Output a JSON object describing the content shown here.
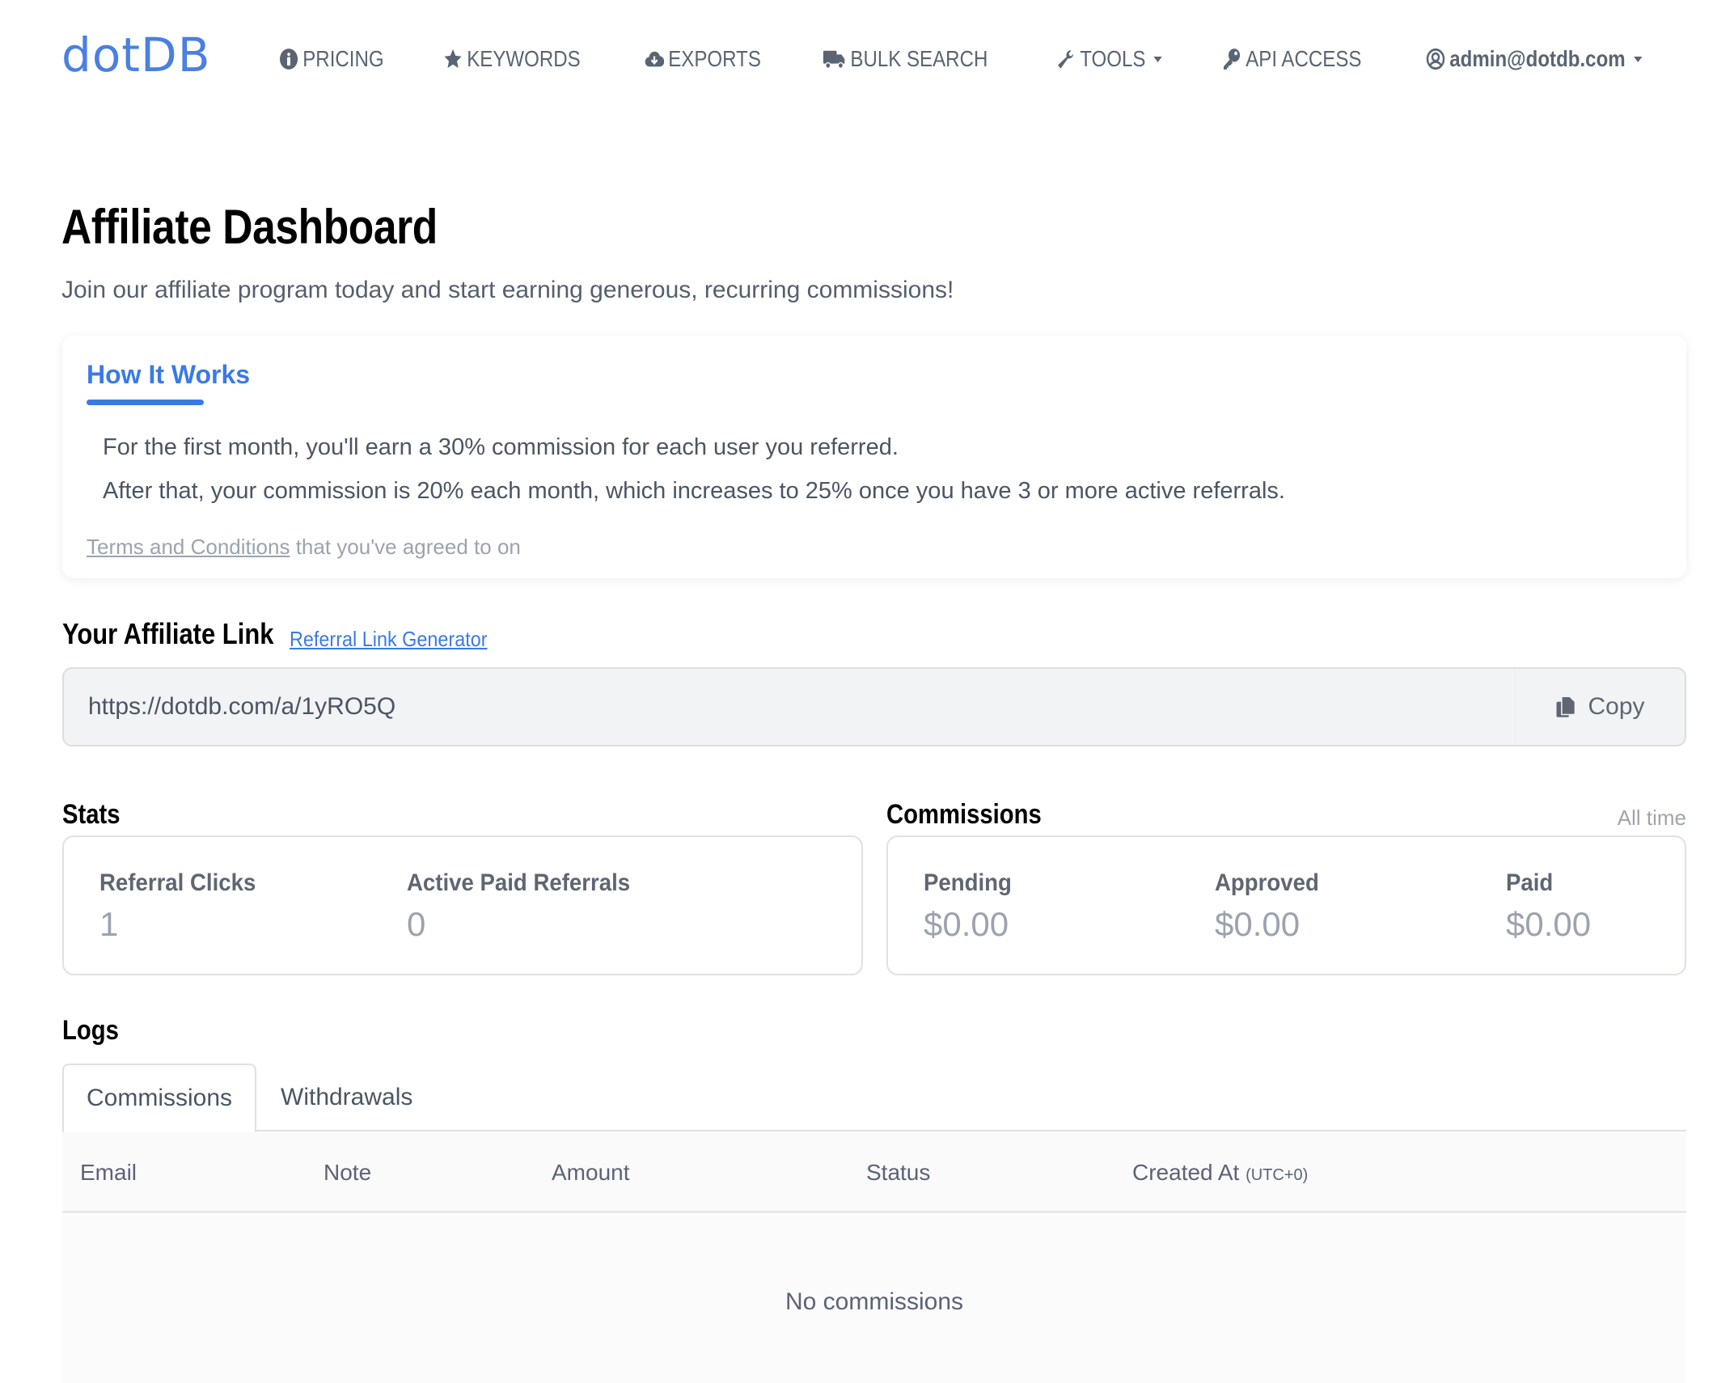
{
  "brand": {
    "logo": "dotDB",
    "accent": "#3b7ae6"
  },
  "nav": {
    "items": [
      {
        "label": "PRICING",
        "icon": "info-circle-icon"
      },
      {
        "label": "KEYWORDS",
        "icon": "star-icon"
      },
      {
        "label": "EXPORTS",
        "icon": "cloud-download-icon"
      },
      {
        "label": "BULK SEARCH",
        "icon": "truck-icon"
      },
      {
        "label": "TOOLS",
        "icon": "wrench-icon",
        "dropdown": true
      },
      {
        "label": "API ACCESS",
        "icon": "key-icon"
      }
    ],
    "user": {
      "label": "admin@dotdb.com",
      "icon": "user-circle-icon",
      "dropdown": true
    }
  },
  "page": {
    "title": "Affiliate Dashboard",
    "subtitle": "Join our affiliate program today and start earning generous, recurring commissions!"
  },
  "how_it_works": {
    "title": "How It Works",
    "lines": [
      "For the first month, you'll earn a 30% commission for each user you referred.",
      "After that, your commission is 20% each month, which increases to 25% once you have 3 or more active referrals."
    ],
    "terms_link": "Terms and Conditions",
    "terms_suffix": " that you've agreed to on"
  },
  "affiliate_link": {
    "heading": "Your Affiliate Link",
    "generator_link": "Referral Link Generator",
    "value": "https://dotdb.com/a/1yRO5Q",
    "copy_label": "Copy"
  },
  "stats": {
    "heading": "Stats",
    "items": [
      {
        "label": "Referral Clicks",
        "value": "1"
      },
      {
        "label": "Active Paid Referrals",
        "value": "0"
      }
    ]
  },
  "commissions": {
    "heading": "Commissions",
    "period": "All time",
    "items": [
      {
        "label": "Pending",
        "value": "$0.00"
      },
      {
        "label": "Approved",
        "value": "$0.00"
      },
      {
        "label": "Paid",
        "value": "$0.00"
      }
    ]
  },
  "logs": {
    "heading": "Logs",
    "tabs": [
      {
        "label": "Commissions",
        "active": true
      },
      {
        "label": "Withdrawals",
        "active": false
      }
    ],
    "columns": [
      "Email",
      "Note",
      "Amount",
      "Status",
      "Created At"
    ],
    "created_suffix": "(UTC+0)",
    "empty_message": "No commissions"
  }
}
